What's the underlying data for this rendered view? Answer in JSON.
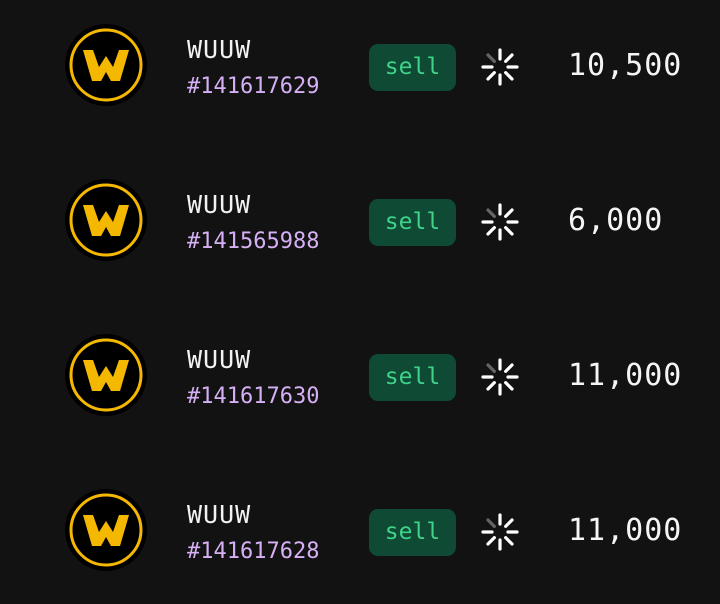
{
  "orders": [
    {
      "token": "WUUW",
      "order_id": "#141617629",
      "side": "sell",
      "amount": "10,500",
      "status_icon": "loading-spinner-icon"
    },
    {
      "token": "WUUW",
      "order_id": "#141565988",
      "side": "sell",
      "amount": "6,000",
      "status_icon": "loading-spinner-icon"
    },
    {
      "token": "WUUW",
      "order_id": "#141617630",
      "side": "sell",
      "amount": "11,000",
      "status_icon": "loading-spinner-icon"
    },
    {
      "token": "WUUW",
      "order_id": "#141617628",
      "side": "sell",
      "amount": "11,000",
      "status_icon": "loading-spinner-icon"
    }
  ],
  "colors": {
    "background": "#121212",
    "token_logo_ring": "#f5b800",
    "token_logo_fill": "#f5b800",
    "order_id": "#d6b0f5",
    "sell_badge_bg": "#0f4a34",
    "sell_badge_text": "#3fd38a"
  },
  "icons": {
    "token_logo": "wuuw-token-logo-icon",
    "status": "loading-spinner-icon"
  }
}
